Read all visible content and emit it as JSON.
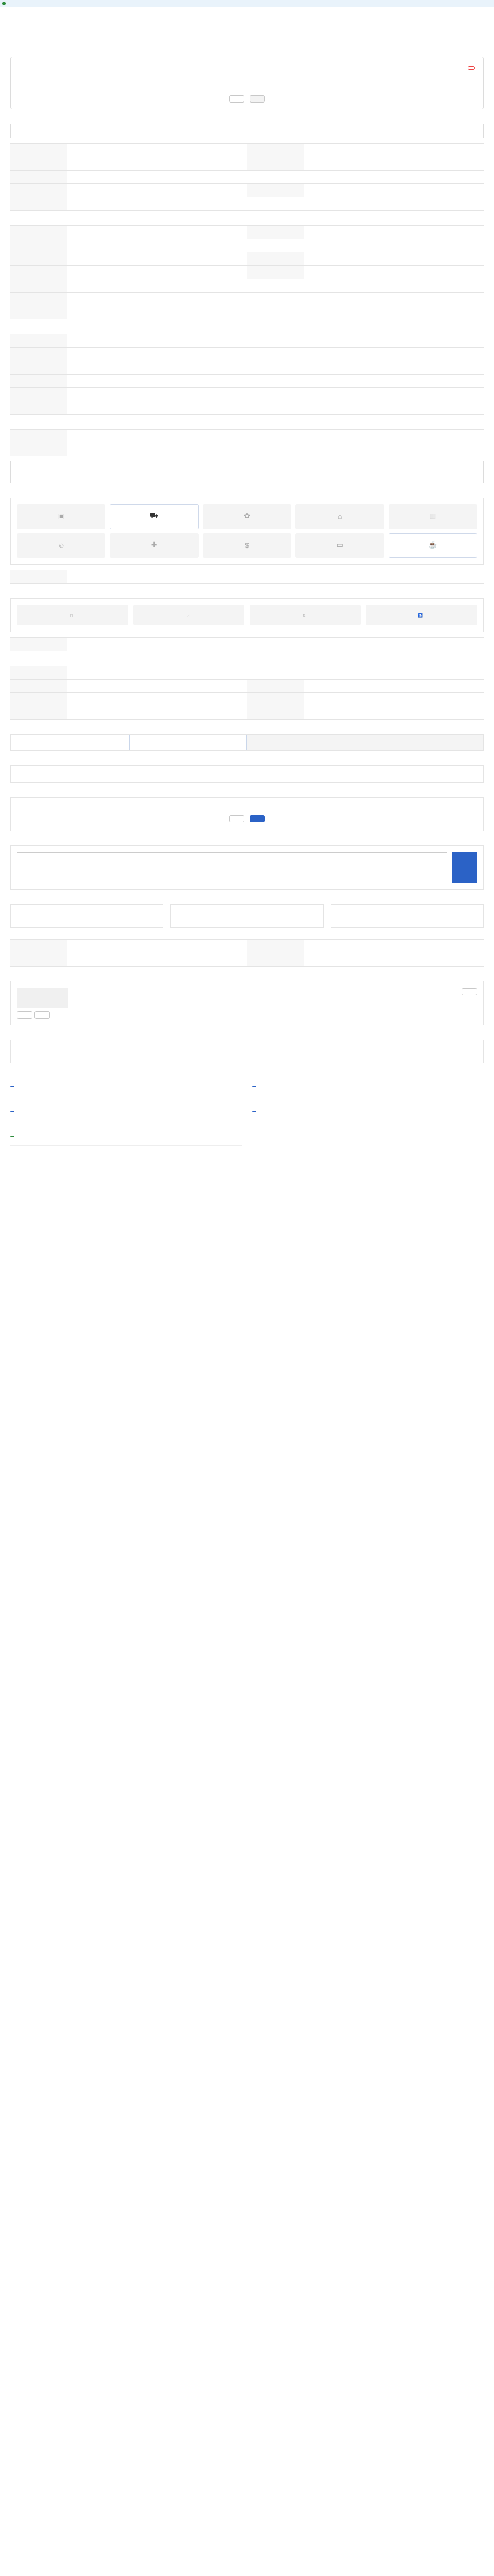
{
  "topbar": {
    "text": ""
  },
  "util": {
    "links": [
      "",
      "",
      ""
    ]
  },
  "gnb": {
    "logo": "",
    "items": [
      "",
      "",
      "",
      "",
      "",
      ""
    ]
  },
  "lnb": {
    "items": [
      "",
      "",
      "",
      "",
      "",
      "",
      "",
      ""
    ]
  },
  "job": {
    "meta_left": "",
    "meta_right": "",
    "company": "",
    "title": "",
    "badge": "",
    "summary": [
      {
        "heading": "",
        "rows": [
          {
            "k": "",
            "v": ""
          },
          {
            "k": "",
            "v": ""
          }
        ]
      },
      {
        "heading": "",
        "rows": [
          {
            "k": "",
            "v": ""
          },
          {
            "k": "",
            "v": ""
          }
        ]
      },
      {
        "heading": "",
        "rows": [
          {
            "k": "",
            "v": ""
          },
          {
            "k": "",
            "v": ""
          }
        ]
      },
      {
        "heading": "",
        "rows": [
          {
            "k": "",
            "v": ""
          }
        ]
      }
    ],
    "btn_apply": "",
    "btn_scrap": ""
  },
  "sections": {
    "recruit": "",
    "conditions": "",
    "preferred": "",
    "other": "",
    "welfare": "",
    "disabled": "",
    "workplace": "",
    "process": "",
    "apply": "",
    "contact": "",
    "inquiry": "",
    "stats": "",
    "stats_date": "",
    "company": "",
    "other_jobs": "",
    "recommend": ""
  },
  "recruit_box": {
    "lines": [
      "",
      "",
      "",
      "",
      ""
    ],
    "more": ""
  },
  "recruit_table": [
    {
      "k": "",
      "v": "",
      "k2": "",
      "v2": ""
    },
    {
      "k": "",
      "v": "",
      "k2": "",
      "v2": ""
    },
    {
      "k": "",
      "v": ""
    },
    {
      "k": "",
      "v": "",
      "k2": "",
      "v2": ""
    },
    {
      "k": "",
      "v": ""
    }
  ],
  "cond_table": [
    {
      "k": "",
      "v": "",
      "k2": "",
      "v2": ""
    },
    {
      "k": "",
      "v": ""
    },
    {
      "k": "",
      "v": "",
      "k2": "",
      "v2": ""
    },
    {
      "k": "",
      "v": "",
      "k2": "",
      "v2": ""
    },
    {
      "k": "",
      "v": ""
    },
    {
      "k": "",
      "v": ""
    },
    {
      "k": "",
      "v": ""
    }
  ],
  "cond_hours": [
    "",
    "",
    "",
    "",
    "",
    ""
  ],
  "cond_note": "",
  "pref_table": [
    {
      "k": "",
      "v": ""
    },
    {
      "k": "",
      "v": ""
    },
    {
      "k": "",
      "v": ""
    },
    {
      "k": "",
      "v": ""
    },
    {
      "k": "",
      "v": ""
    },
    {
      "k": "",
      "v": ""
    }
  ],
  "other_table": [
    {
      "k": "",
      "v": ""
    },
    {
      "k": "",
      "v": ""
    }
  ],
  "other_more": "",
  "welfare": {
    "items": [
      {
        "label": "",
        "on": false,
        "icon": "box-icon"
      },
      {
        "label": "",
        "on": true,
        "icon": "car-icon"
      },
      {
        "label": "",
        "on": false,
        "icon": "gift-icon"
      },
      {
        "label": "",
        "on": false,
        "icon": "home-icon"
      },
      {
        "label": "",
        "on": false,
        "icon": "calendar-icon"
      },
      {
        "label": "",
        "on": false,
        "icon": "people-icon"
      },
      {
        "label": "",
        "on": false,
        "icon": "hospital-icon"
      },
      {
        "label": "",
        "on": false,
        "icon": "dollar-icon"
      },
      {
        "label": "",
        "on": false,
        "icon": "monitor-icon"
      },
      {
        "label": "",
        "on": true,
        "icon": "meal-icon"
      }
    ],
    "table": [
      {
        "k": "",
        "v": ""
      }
    ]
  },
  "disabled_facilities": {
    "items": [
      {
        "label": "",
        "icon": "door-icon"
      },
      {
        "label": "",
        "icon": "ramp-icon"
      },
      {
        "label": "",
        "icon": "elevator-icon"
      },
      {
        "label": "",
        "icon": "wheelchair-icon"
      }
    ],
    "table": [
      {
        "k": "",
        "v": ""
      }
    ]
  },
  "workplace_table": [
    {
      "k": "",
      "v": ""
    },
    {
      "k": "",
      "v": "",
      "k2": "",
      "v2": ""
    },
    {
      "k": "",
      "v": "",
      "k2": "",
      "v2": ""
    },
    {
      "k": "",
      "v": "",
      "k2": "",
      "v2": ""
    }
  ],
  "process_steps": [
    {
      "label": "",
      "on": true
    },
    {
      "label": "",
      "on": true
    },
    {
      "label": "",
      "on": false
    },
    {
      "label": "",
      "on": false
    }
  ],
  "apply": {
    "left": [
      {
        "lbl": "",
        "val": ""
      },
      {
        "lbl": "",
        "val": ""
      }
    ],
    "right": [
      {
        "lbl": "",
        "val": ""
      },
      {
        "lbl": "",
        "val": ""
      },
      {
        "lbl": "",
        "val": ""
      }
    ]
  },
  "apply_notes": [
    "",
    "",
    "",
    "",
    ""
  ],
  "contact": {
    "warn": "",
    "desc": "",
    "btn_phone": "",
    "btn_form": ""
  },
  "inquiry": {
    "placeholder": "",
    "count": "",
    "send": "",
    "notes": [
      "",
      "",
      ""
    ],
    "btn_more": ""
  },
  "stats": [
    {
      "label": "",
      "value": ""
    },
    {
      "label": "",
      "value": ""
    },
    {
      "label": "",
      "value": ""
    }
  ],
  "stats_note": "",
  "source_table": [
    {
      "k": "",
      "v": "",
      "k2": "",
      "v2": ""
    },
    {
      "k": "",
      "v": "",
      "k2": "",
      "v2": ""
    }
  ],
  "source_note": "",
  "company": {
    "logo": "",
    "rows": [
      {
        "k": "",
        "v": ""
      },
      {
        "k": "",
        "v": ""
      },
      {
        "k": "",
        "v": ""
      }
    ],
    "rows2": [
      {
        "k": "",
        "v": ""
      },
      {
        "k": "",
        "v": ""
      },
      {
        "k": "",
        "v": ""
      }
    ],
    "btn_home": "",
    "btn_a": "",
    "btn_b": ""
  },
  "other_jobs": {
    "empty": ""
  },
  "recommend": [
    {
      "tag": "",
      "company": "",
      "title": "",
      "sub": "",
      "green": false
    },
    {
      "tag": "",
      "company": "",
      "title": "",
      "sub": "",
      "green": false
    },
    {
      "tag": "",
      "company": "",
      "title": "",
      "sub": "",
      "green": false
    },
    {
      "tag": "",
      "company": "",
      "title": "",
      "sub": "",
      "green": false
    },
    {
      "tag": "",
      "company": "",
      "title": "",
      "sub": "",
      "green": true
    }
  ]
}
